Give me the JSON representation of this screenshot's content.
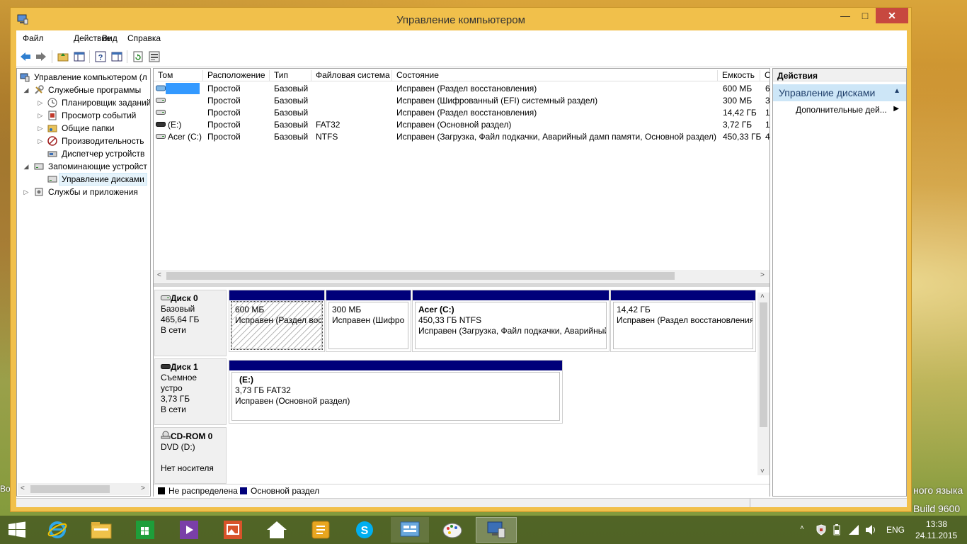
{
  "desktop": {
    "lang_text": "ного языка",
    "build_text": "Build 9600",
    "left_hint1": "A",
    "left_hint2": "Во"
  },
  "window": {
    "title": "Управление компьютером",
    "buttons": {
      "minimize": "—",
      "maximize": "□",
      "close": "✕"
    }
  },
  "menu": {
    "file": "Файл",
    "action": "Действие",
    "view": "Вид",
    "help": "Справка"
  },
  "toolbar": {
    "icons": [
      "back-icon",
      "forward-icon",
      "folder-up-icon",
      "console-tree-icon",
      "help-icon",
      "show-hide-icon",
      "refresh-icon",
      "properties-icon"
    ]
  },
  "tree": {
    "root": "Управление компьютером (л",
    "system_tools": "Служебные программы",
    "task_scheduler": "Планировщик заданий",
    "event_viewer": "Просмотр событий",
    "shared_folders": "Общие папки",
    "performance": "Производительность",
    "device_manager": "Диспетчер устройств",
    "storage": "Запоминающие устройст",
    "disk_management": "Управление дисками",
    "services_apps": "Службы и приложения"
  },
  "volumes": {
    "headers": [
      "Том",
      "Расположение",
      "Тип",
      "Файловая система",
      "Состояние",
      "Емкость",
      "С"
    ],
    "rows": [
      {
        "name": "",
        "layout": "Простой",
        "type": "Базовый",
        "fs": "",
        "status": "Исправен (Раздел восстановления)",
        "capacity": "600 МБ",
        "extra": "6"
      },
      {
        "name": "",
        "layout": "Простой",
        "type": "Базовый",
        "fs": "",
        "status": "Исправен (Шифрованный (EFI) системный раздел)",
        "capacity": "300 МБ",
        "extra": "3"
      },
      {
        "name": "",
        "layout": "Простой",
        "type": "Базовый",
        "fs": "",
        "status": "Исправен (Раздел восстановления)",
        "capacity": "14,42 ГБ",
        "extra": "1"
      },
      {
        "name": "(E:)",
        "layout": "Простой",
        "type": "Базовый",
        "fs": "FAT32",
        "status": "Исправен (Основной раздел)",
        "capacity": "3,72 ГБ",
        "extra": "1"
      },
      {
        "name": "Acer (C:)",
        "layout": "Простой",
        "type": "Базовый",
        "fs": "NTFS",
        "status": "Исправен (Загрузка, Файл подкачки, Аварийный дамп памяти, Основной раздел)",
        "capacity": "450,33 ГБ",
        "extra": "4"
      }
    ]
  },
  "disks": {
    "disk0": {
      "name": "Диск 0",
      "type": "Базовый",
      "size": "465,64 ГБ",
      "state": "В сети",
      "parts": [
        {
          "title": "",
          "line1": "600 МБ",
          "line2": "Исправен (Раздел вос"
        },
        {
          "title": "",
          "line1": "300 МБ",
          "line2": "Исправен (Шифро"
        },
        {
          "title": "Acer  (C:)",
          "line1": "450,33 ГБ NTFS",
          "line2": "Исправен (Загрузка, Файл подкачки, Аварийный"
        },
        {
          "title": "",
          "line1": "14,42 ГБ",
          "line2": "Исправен (Раздел восстановления)"
        }
      ]
    },
    "disk1": {
      "name": "Диск 1",
      "type": "Съемное устро",
      "size": "3,73 ГБ",
      "state": "В сети",
      "parts": [
        {
          "title": "(E:)",
          "line1": "3,73 ГБ FAT32",
          "line2": "Исправен (Основной раздел)"
        }
      ]
    },
    "cdrom": {
      "name": "CD-ROM 0",
      "type": "DVD (D:)",
      "state": "Нет носителя"
    }
  },
  "legend": {
    "unallocated": "Не распределена",
    "primary": "Основной раздел",
    "unallocated_color": "#000000",
    "primary_color": "#00007a"
  },
  "actions": {
    "header": "Действия",
    "section": "Управление дисками",
    "more": "Дополнительные дей..."
  },
  "taskbar": {
    "apps": [
      "start-icon",
      "ie-icon",
      "explorer-icon",
      "store-icon",
      "video-icon",
      "photos-icon",
      "home-icon",
      "notes-icon",
      "skype-icon",
      "control-panel-icon",
      "paint-icon",
      "computer-management-icon"
    ],
    "lang": "ENG",
    "time": "13:38",
    "date": "24.11.2015"
  }
}
